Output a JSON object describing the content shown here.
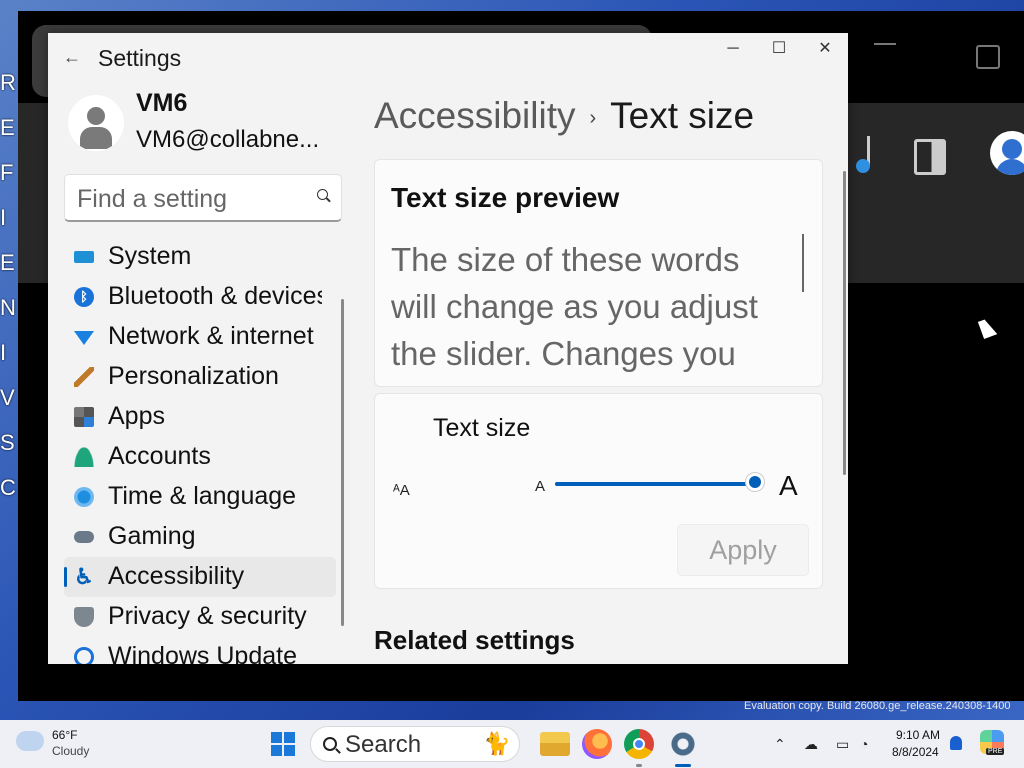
{
  "window": {
    "title": "Settings",
    "minimize_glyph": "─",
    "maximize_glyph": "☐",
    "close_glyph": "✕"
  },
  "user": {
    "name": "VM6",
    "email": "VM6@collabne..."
  },
  "search": {
    "placeholder": "Find a setting"
  },
  "nav": {
    "items": [
      {
        "label": "System",
        "icon": "system-icon"
      },
      {
        "label": "Bluetooth & devices",
        "icon": "bluetooth-icon"
      },
      {
        "label": "Network & internet",
        "icon": "network-icon"
      },
      {
        "label": "Personalization",
        "icon": "brush-icon"
      },
      {
        "label": "Apps",
        "icon": "apps-icon"
      },
      {
        "label": "Accounts",
        "icon": "accounts-icon"
      },
      {
        "label": "Time & language",
        "icon": "time-language-icon"
      },
      {
        "label": "Gaming",
        "icon": "gaming-icon"
      },
      {
        "label": "Accessibility",
        "icon": "accessibility-icon",
        "active": true
      },
      {
        "label": "Privacy & security",
        "icon": "shield-icon"
      },
      {
        "label": "Windows Update",
        "icon": "update-icon"
      }
    ]
  },
  "breadcrumb": {
    "parent": "Accessibility",
    "separator": "›",
    "current": "Text size"
  },
  "preview": {
    "title": "Text size preview",
    "text": "The size of these words will change as you adjust the slider. Changes you"
  },
  "slider_card": {
    "title": "Text size",
    "icon_glyph": "ᴬA",
    "min_label": "A",
    "max_label": "A",
    "value_fraction": 1.0,
    "apply_label": "Apply"
  },
  "related": {
    "title": "Related settings"
  },
  "taskbar": {
    "weather_temp": "66°F",
    "weather_condition": "Cloudy",
    "search_label": "Search",
    "time": "9:10 AM",
    "date": "8/8/2024"
  },
  "watermark": "Evaluation copy. Build 26080.ge_release.240308-1400",
  "colors": {
    "accent": "#005fb8",
    "window_bg": "#f3f3f3",
    "card_bg": "#fbfbfb"
  }
}
